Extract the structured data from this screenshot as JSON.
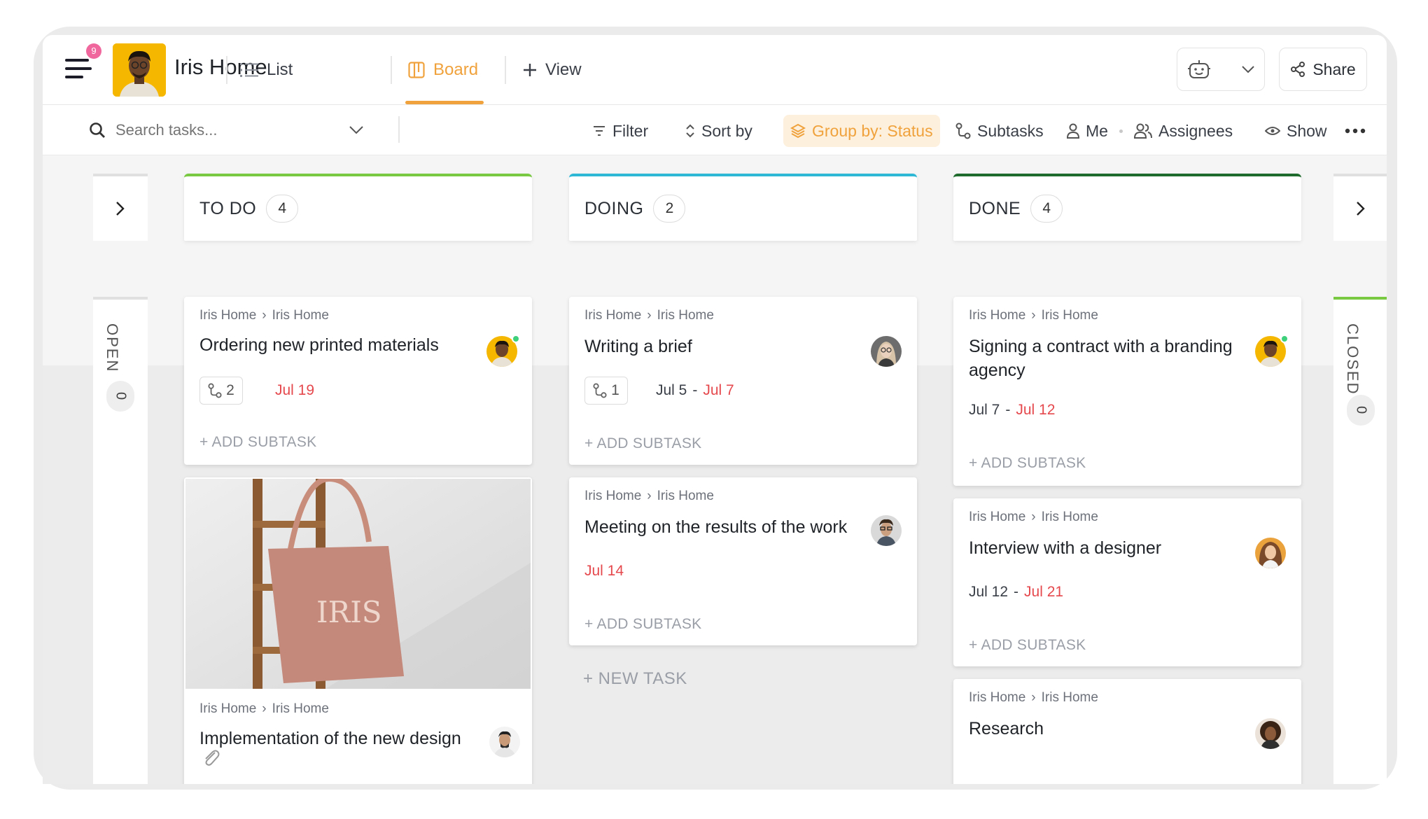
{
  "header": {
    "notification_count": "9",
    "workspace_title": "Iris Home",
    "tabs": [
      {
        "label": "List"
      },
      {
        "label": "Board"
      },
      {
        "label": "View"
      }
    ],
    "share_label": "Share"
  },
  "toolbar": {
    "search_placeholder": "Search tasks...",
    "filter": "Filter",
    "sort": "Sort by",
    "group": "Group by: Status",
    "subtasks": "Subtasks",
    "me": "Me",
    "assignees": "Assignees",
    "show": "Show"
  },
  "board": {
    "left_side": {
      "label": "OPEN",
      "count": "0"
    },
    "right_side": {
      "label": "CLOSED",
      "count": "0"
    },
    "columns": [
      {
        "title": "TO DO",
        "count": "4",
        "color": "#7ac943"
      },
      {
        "title": "DOING",
        "count": "2",
        "color": "#2fb8d6"
      },
      {
        "title": "DONE",
        "count": "4",
        "color": "#1f6b2e"
      }
    ],
    "cards": [
      {
        "crumb_a": "Iris Home",
        "crumb_b": "Iris Home",
        "title": "Ordering new printed materials",
        "subtasks": "2",
        "due": "Jul 19",
        "add_subtask": "+ ADD SUBTASK"
      },
      {
        "crumb_a": "Iris Home",
        "crumb_b": "Iris Home",
        "title": "Implementation of the new design",
        "image_text": "IRIS"
      },
      {
        "crumb_a": "Iris Home",
        "crumb_b": "Iris Home",
        "title": "Writing a brief",
        "subtasks": "1",
        "start": "Jul 5",
        "due": "Jul 7",
        "add_subtask": "+ ADD SUBTASK"
      },
      {
        "crumb_a": "Iris Home",
        "crumb_b": "Iris Home",
        "title": "Meeting on the results of the work",
        "due": "Jul 14",
        "add_subtask": "+ ADD SUBTASK"
      },
      {
        "crumb_a": "Iris Home",
        "crumb_b": "Iris Home",
        "title_line1": "Signing a contract with a branding",
        "title_line2": "agency",
        "start": "Jul 7",
        "due": "Jul 12",
        "add_subtask": "+ ADD SUBTASK"
      },
      {
        "crumb_a": "Iris Home",
        "crumb_b": "Iris Home",
        "title": "Interview with a designer",
        "start": "Jul 12",
        "due": "Jul 21",
        "add_subtask": "+ ADD SUBTASK"
      },
      {
        "crumb_a": "Iris Home",
        "crumb_b": "Iris Home",
        "title": "Research"
      }
    ],
    "new_task": "+ NEW TASK"
  }
}
